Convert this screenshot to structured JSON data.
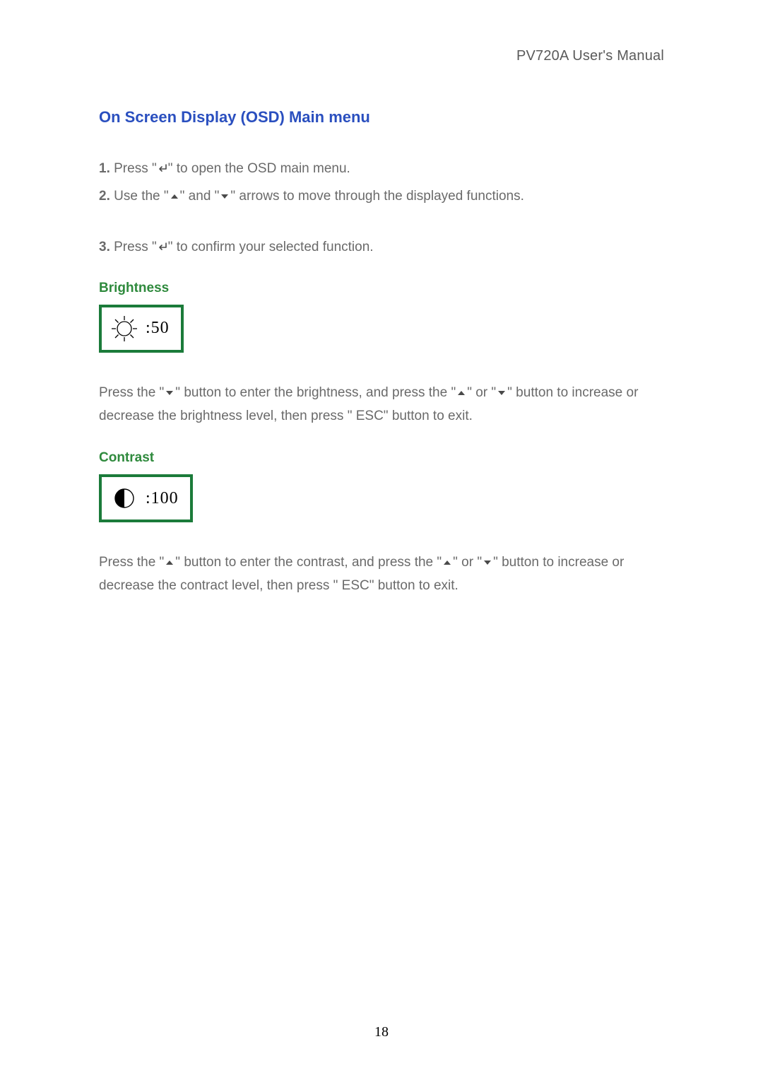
{
  "header": {
    "title": "PV720A User's Manual"
  },
  "section": {
    "title": "On Screen Display (OSD) Main menu"
  },
  "steps": {
    "n1": "1.",
    "t1a": " Press \"",
    "t1b": "\" to open the OSD main menu.",
    "n2": "2.",
    "t2a": " Use the \"",
    "t2b": "\" and \"",
    "t2c": "\" arrows to move through the displayed functions.",
    "n3": "3.",
    "t3a": " Press \"",
    "t3b": "\" to confirm your selected function."
  },
  "brightness": {
    "heading": "Brightness",
    "value": ":50",
    "desc_a": "Press the \"",
    "desc_b": "\" button to enter the brightness, and press the \"",
    "desc_c": "\" or \"",
    "desc_d": "\" button to increase or decrease the brightness level, then press \" ESC\" button to exit."
  },
  "contrast": {
    "heading": "Contrast",
    "value": ":100",
    "desc_a": "Press the \"",
    "desc_b": "\" button to enter the contrast, and press the \"",
    "desc_c": "\" or \"",
    "desc_d": "\" button to increase or decrease the contract level, then press \" ESC\" button to exit."
  },
  "page_number": "18",
  "icons": {
    "enter": "enter-icon",
    "up": "up-arrow-icon",
    "down": "down-arrow-icon",
    "sun": "brightness-sun-icon",
    "contrast": "contrast-circle-icon"
  }
}
